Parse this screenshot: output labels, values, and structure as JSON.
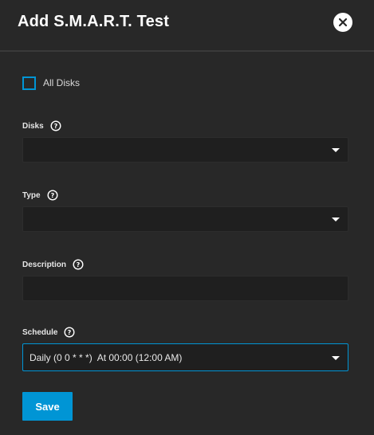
{
  "dialog": {
    "title": "Add S.M.A.R.T. Test",
    "close_icon": "close-icon"
  },
  "form": {
    "all_disks": {
      "label": "All Disks",
      "checked": false
    },
    "disks": {
      "label": "Disks",
      "value": ""
    },
    "type": {
      "label": "Type",
      "value": ""
    },
    "description": {
      "label": "Description",
      "value": ""
    },
    "schedule": {
      "label": "Schedule",
      "value": "Daily (0 0 * * *)  At 00:00 (12:00 AM)"
    }
  },
  "actions": {
    "save_label": "Save"
  },
  "colors": {
    "accent": "#0095d5",
    "background": "#282828",
    "field_background": "#1f1f1f"
  }
}
